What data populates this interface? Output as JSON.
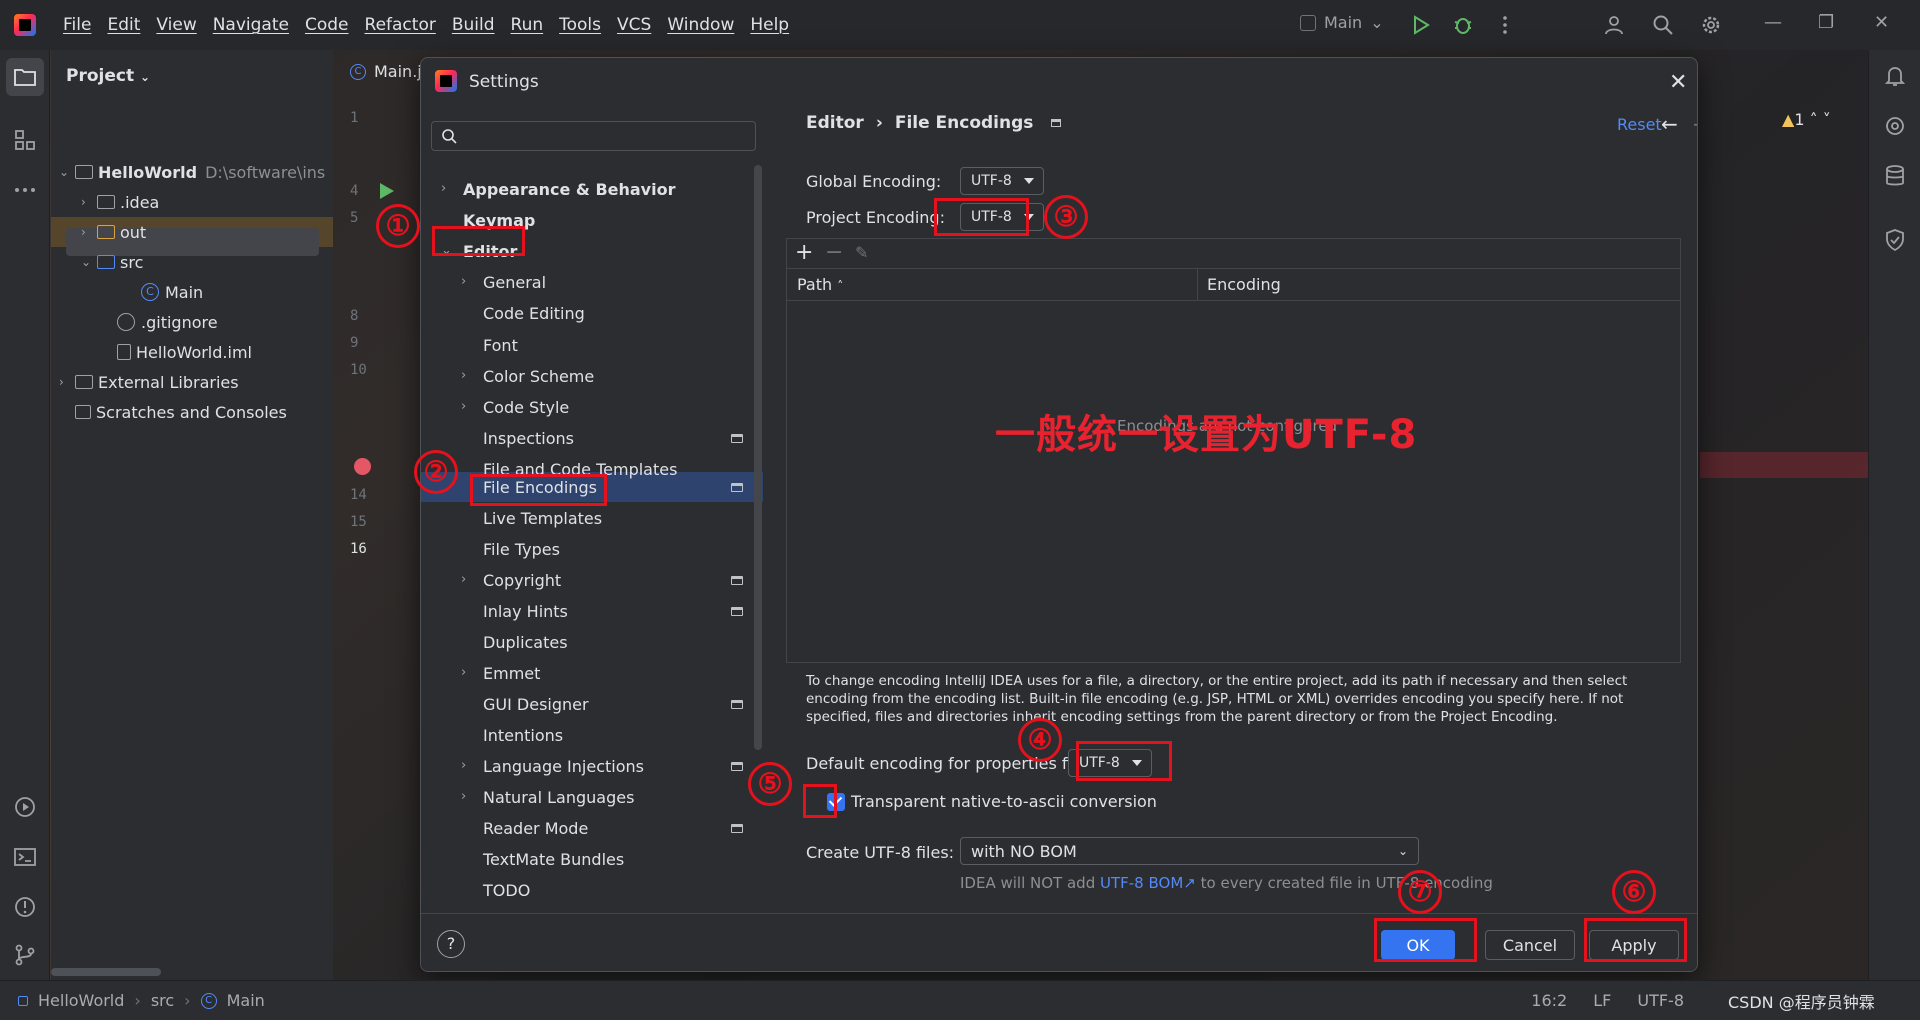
{
  "menu": [
    "File",
    "Edit",
    "View",
    "Navigate",
    "Code",
    "Refactor",
    "Build",
    "Run",
    "Tools",
    "VCS",
    "Window",
    "Help"
  ],
  "run_config": "Main",
  "project_panel": {
    "title": "Project",
    "tree": [
      {
        "label": "HelloWorld",
        "path": "D:\\software\\ins"
      },
      {
        "label": ".idea"
      },
      {
        "label": "out"
      },
      {
        "label": "src"
      },
      {
        "label": "Main"
      },
      {
        "label": ".gitignore"
      },
      {
        "label": "HelloWorld.iml"
      },
      {
        "label": "External Libraries"
      },
      {
        "label": "Scratches and Consoles"
      }
    ]
  },
  "editor": {
    "tab": "Main.j",
    "line_numbers": [
      "1",
      "4",
      "5",
      "8",
      "9",
      "10",
      "14",
      "15",
      "16"
    ],
    "warnings": "1"
  },
  "dialog": {
    "title": "Settings",
    "search_placeholder": "",
    "tree": [
      {
        "label": "Appearance & Behavior"
      },
      {
        "label": "Keymap"
      },
      {
        "label": "Editor"
      },
      {
        "label": "General"
      },
      {
        "label": "Code Editing"
      },
      {
        "label": "Font"
      },
      {
        "label": "Color Scheme"
      },
      {
        "label": "Code Style"
      },
      {
        "label": "Inspections"
      },
      {
        "label": "File and Code Templates"
      },
      {
        "label": "File Encodings"
      },
      {
        "label": "Live Templates"
      },
      {
        "label": "File Types"
      },
      {
        "label": "Copyright"
      },
      {
        "label": "Inlay Hints"
      },
      {
        "label": "Duplicates"
      },
      {
        "label": "Emmet"
      },
      {
        "label": "GUI Designer"
      },
      {
        "label": "Intentions"
      },
      {
        "label": "Language Injections"
      },
      {
        "label": "Natural Languages"
      },
      {
        "label": "Reader Mode"
      },
      {
        "label": "TextMate Bundles"
      },
      {
        "label": "TODO"
      }
    ],
    "breadcrumb": [
      "Editor",
      "File Encodings"
    ],
    "reset": "Reset",
    "global_encoding_label": "Global Encoding:",
    "global_encoding": "UTF-8",
    "project_encoding_label": "Project Encoding:",
    "project_encoding": "UTF-8",
    "table": {
      "col_path": "Path",
      "col_encoding": "Encoding",
      "empty": "Encodings are not configured"
    },
    "help_text": "To change encoding IntelliJ IDEA uses for a file, a directory, or the entire project, add its path if necessary and then select encoding from the encoding list. Built-in file encoding (e.g. JSP, HTML or XML) overrides encoding you specify here. If not specified, files and directories inherit encoding settings from the parent directory or from the Project Encoding.",
    "properties_label": "Default encoding for properties files:",
    "properties_encoding": "UTF-8",
    "native_ascii_label": "Transparent native-to-ascii conversion",
    "create_utf8_label": "Create UTF-8 files:",
    "create_utf8_value": "with NO BOM",
    "bom_hint_prefix": "IDEA will NOT add",
    "bom_hint_link": "UTF-8 BOM",
    "bom_hint_suffix": "to every created file in UTF-8 encoding",
    "buttons": {
      "ok": "OK",
      "cancel": "Cancel",
      "apply": "Apply"
    },
    "help": "?"
  },
  "annotations": {
    "note": "一般统一设置为UTF-8",
    "markers": [
      "①",
      "②",
      "③",
      "④",
      "⑤",
      "⑥",
      "⑦"
    ]
  },
  "status_bar": {
    "crumbs": [
      "HelloWorld",
      "src",
      "Main"
    ],
    "position": "16:2",
    "line_sep": "LF",
    "encoding": "UTF-8"
  },
  "watermark": "CSDN @程序员钟霖",
  "colors": {
    "accent": "#3574f0",
    "annotation": "#e5121e",
    "link": "#548af7"
  }
}
